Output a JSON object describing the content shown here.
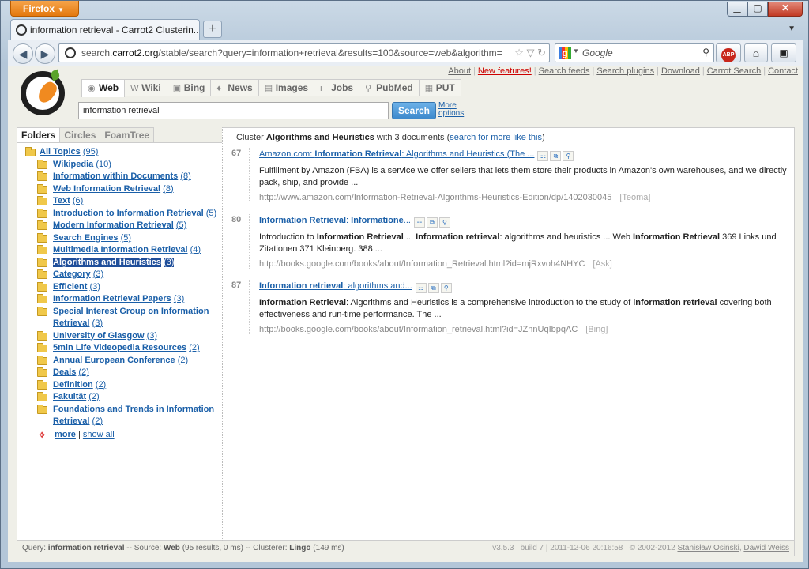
{
  "browser": {
    "app_button": "Firefox",
    "tab_title": "information retrieval - Carrot2 Clusterin...",
    "new_tab": "+",
    "url_prefix": "search.",
    "url_host": "carrot2.org",
    "url_path": "/stable/search?query=information+retrieval&results=100&source=web&algorithm=",
    "search_engine_placeholder": "Google"
  },
  "toplinks": [
    "About",
    "New features!",
    "Search feeds",
    "Search plugins",
    "Download",
    "Carrot Search",
    "Contact"
  ],
  "sources": [
    {
      "label": "Web",
      "icon": "web-globe-icon",
      "active": true
    },
    {
      "label": "Wiki",
      "icon": "wiki-w-icon",
      "active": false
    },
    {
      "label": "Bing",
      "icon": "bing-icon",
      "active": false
    },
    {
      "label": "News",
      "icon": "news-bulb-icon",
      "active": false
    },
    {
      "label": "Images",
      "icon": "images-icon",
      "active": false
    },
    {
      "label": "Jobs",
      "icon": "jobs-icon",
      "active": false
    },
    {
      "label": "PubMed",
      "icon": "pubmed-icon",
      "active": false
    },
    {
      "label": "PUT",
      "icon": "put-icon",
      "active": false
    }
  ],
  "query": {
    "value": "information retrieval",
    "search_button": "Search",
    "more_options_line1": "More",
    "more_options_line2": "options"
  },
  "view_tabs": [
    "Folders",
    "Circles",
    "FoamTree"
  ],
  "folders": [
    {
      "label": "All Topics",
      "count": "(95)",
      "root": true
    },
    {
      "label": "Wikipedia",
      "count": "(10)"
    },
    {
      "label": "Information within Documents",
      "count": "(8)"
    },
    {
      "label": "Web Information Retrieval",
      "count": "(8)"
    },
    {
      "label": "Text",
      "count": "(6)"
    },
    {
      "label": "Introduction to Information Retrieval",
      "count": "(5)",
      "wrap": true
    },
    {
      "label": "Modern Information Retrieval",
      "count": "(5)"
    },
    {
      "label": "Search Engines",
      "count": "(5)"
    },
    {
      "label": "Multimedia Information Retrieval",
      "count": "(4)"
    },
    {
      "label": "Algorithms and Heuristics",
      "count": "(3)",
      "selected": true
    },
    {
      "label": "Category",
      "count": "(3)"
    },
    {
      "label": "Efficient",
      "count": "(3)"
    },
    {
      "label": "Information Retrieval Papers",
      "count": "(3)"
    },
    {
      "label": "Special Interest Group on Information Retrieval",
      "count": "(3)",
      "wrap": true
    },
    {
      "label": "University of Glasgow",
      "count": "(3)"
    },
    {
      "label": "5min Life Videopedia Resources",
      "count": "(2)"
    },
    {
      "label": "Annual European Conference",
      "count": "(2)"
    },
    {
      "label": "Deals",
      "count": "(2)"
    },
    {
      "label": "Definition",
      "count": "(2)"
    },
    {
      "label": "Fakultät",
      "count": "(2)"
    },
    {
      "label": "Foundations and Trends in Information Retrieval",
      "count": "(2)",
      "wrap": true
    }
  ],
  "folders_more": "more",
  "folders_showall": "show all",
  "cluster_header": {
    "prefix": "Cluster",
    "name": "Algorithms and Heuristics",
    "with": "with",
    "count": "3",
    "suffix": "documents (",
    "link": "search for more like this",
    "close": ")"
  },
  "results": [
    {
      "rank": "67",
      "title_html": "Amazon.com: <b>Information Retrieval</b>: Algorithms and Heuristics (The ...",
      "snippet_html": "Fulfillment by Amazon (FBA) is a service we offer sellers that lets them store their products in Amazon's own warehouses, and we directly pack, ship, and provide ...",
      "url": "http://www.amazon.com/Information-Retrieval-Algorithms-Heuristics-Edition/dp/1402030045",
      "source": "[Teoma]"
    },
    {
      "rank": "80",
      "title_html": "<b>Information Retrieval</b>: <b>Informatione</b>...",
      "snippet_html": "Introduction to <b>Information Retrieval</b> ... <b>Information retrieval</b>: algorithms and heuristics ... Web <b>Information Retrieval</b> 369 Links und Zitationen 371 Kleinberg. 388 ...",
      "url": "http://books.google.com/books/about/Information_Retrieval.html?id=mjRxvoh4NHYC",
      "source": "[Ask]"
    },
    {
      "rank": "87",
      "title_html": "<b>Information retrieval</b>: algorithms and...",
      "snippet_html": "<b>Information Retrieval</b>: Algorithms and Heuristics is a comprehensive introduction to the study of <b>information retrieval</b> covering both effectiveness and run-time performance. The ...",
      "url": "http://books.google.com/books/about/Information_retrieval.html?id=JZnnUqIbpqAC",
      "source": "[Bing]"
    }
  ],
  "status": {
    "query_label": "Query:",
    "query": "information retrieval",
    "source_label": "-- Source:",
    "source": "Web",
    "source_detail": "(95 results, 0 ms)",
    "clusterer_label": "-- Clusterer:",
    "clusterer": "Lingo",
    "clusterer_detail": "(149 ms)",
    "version": "v3.5.3 | build 7 | 2011-12-06 20:16:58",
    "copyright": "© 2002-2012",
    "author1": "Stanisław Osiński",
    "author2": "Dawid Weiss"
  }
}
